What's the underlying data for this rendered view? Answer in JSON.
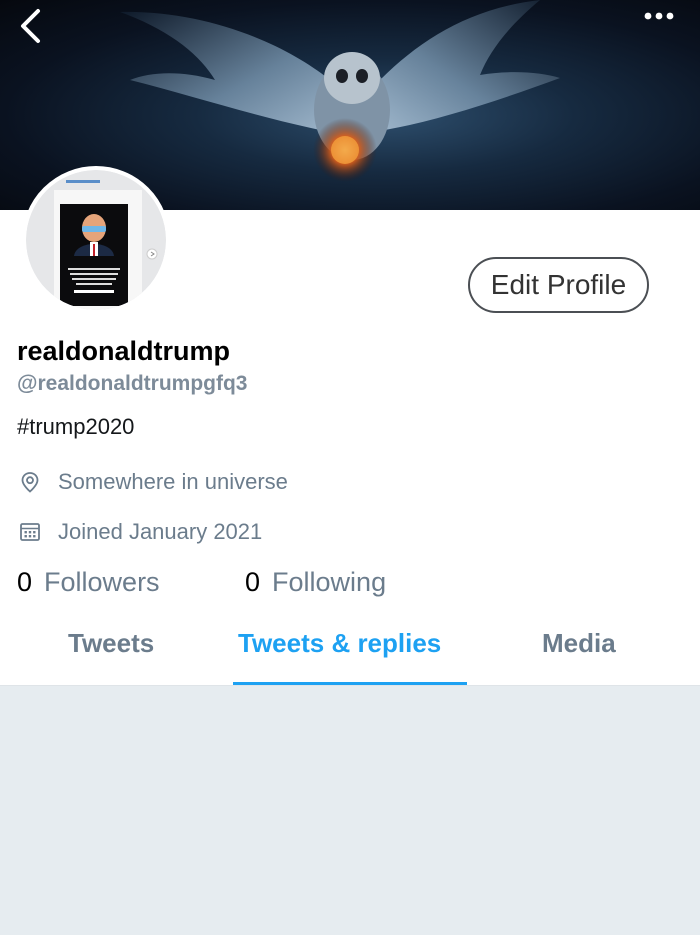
{
  "header": {
    "back_icon": "chevron-left-icon",
    "more_icon": "more-dots-icon"
  },
  "profile": {
    "display_name": "realdonaldtrump",
    "handle": "@realdonaldtrumpgfq3",
    "bio": "#trump2020",
    "location": "Somewhere in universe",
    "joined": "Joined January 2021",
    "edit_button_label": "Edit Profile"
  },
  "stats": {
    "followers_count": "0",
    "followers_label": "Followers",
    "following_count": "0",
    "following_label": "Following"
  },
  "tabs": [
    {
      "label": "Tweets",
      "active": false
    },
    {
      "label": "Tweets & replies",
      "active": true
    },
    {
      "label": "Media",
      "active": false
    }
  ],
  "colors": {
    "accent": "#1da1f2",
    "muted_text": "#6b7c8c",
    "feed_background": "#e6ecf0"
  }
}
